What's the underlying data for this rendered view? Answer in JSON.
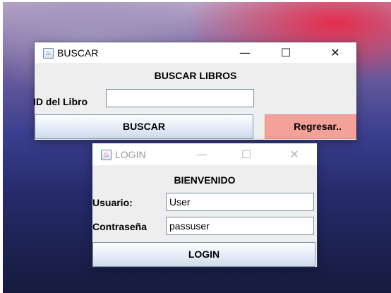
{
  "buscar_window": {
    "title": "BUSCAR",
    "heading": "BUSCAR LIBROS",
    "id_label": "ID del Libro",
    "id_value": "",
    "search_button": "BUSCAR",
    "back_button": "Regresar..",
    "controls": {
      "minimize": "—",
      "maximize": "☐",
      "close": "✕"
    }
  },
  "login_window": {
    "title": "LOGIN",
    "heading": "BIENVENIDO",
    "user_label": "Usuario:",
    "user_value": "User",
    "password_label": "Contraseña",
    "password_value": "passuser",
    "login_button": "LOGIN",
    "controls": {
      "minimize": "—",
      "maximize": "☐",
      "close": "✕"
    }
  },
  "colors": {
    "back_button_bg": "#f4a199",
    "window_bg": "#eeeeee",
    "titlebar_bg": "#ffffff"
  },
  "icons": {
    "window_icon": "java-cup-icon"
  }
}
